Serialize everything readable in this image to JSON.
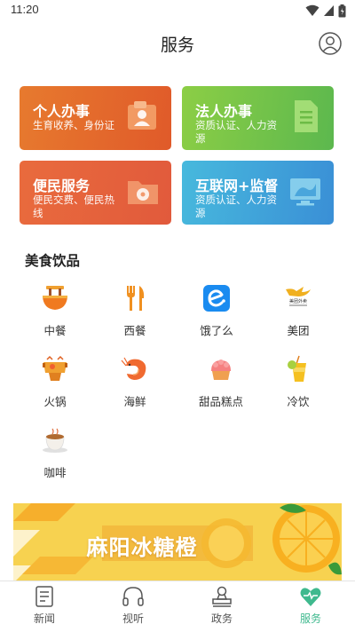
{
  "status_bar": {
    "time": "11:20"
  },
  "header": {
    "title": "服务"
  },
  "service_cards": [
    {
      "title": "个人办事",
      "subtitle": "生育收养、身份证"
    },
    {
      "title": "法人办事",
      "subtitle": "资质认证、人力资源"
    },
    {
      "title": "便民服务",
      "subtitle": "便民交费、便民热线"
    },
    {
      "title": "互联网+监督",
      "subtitle": "资质认证、人力资源"
    }
  ],
  "food_section": {
    "title": "美食饮品",
    "items": [
      {
        "label": "中餐",
        "icon": "noodle-bowl-icon"
      },
      {
        "label": "西餐",
        "icon": "fork-knife-icon"
      },
      {
        "label": "饿了么",
        "icon": "eleme-logo-icon"
      },
      {
        "label": "美团",
        "icon": "meituan-logo-icon"
      },
      {
        "label": "火锅",
        "icon": "hotpot-icon"
      },
      {
        "label": "海鲜",
        "icon": "shrimp-icon"
      },
      {
        "label": "甜品糕点",
        "icon": "cake-icon"
      },
      {
        "label": "冷饮",
        "icon": "cold-drink-icon"
      },
      {
        "label": "咖啡",
        "icon": "coffee-icon"
      }
    ]
  },
  "banner": {
    "text": "麻阳冰糖橙"
  },
  "tab_bar": {
    "tabs": [
      {
        "label": "新闻",
        "icon": "news-icon",
        "active": false
      },
      {
        "label": "视听",
        "icon": "headphones-icon",
        "active": false
      },
      {
        "label": "政务",
        "icon": "government-icon",
        "active": false
      },
      {
        "label": "服务",
        "icon": "service-heart-icon",
        "active": true
      }
    ],
    "active_color": "#3fb98e"
  },
  "colors": {
    "card_personal": "#e56a2c",
    "card_legal": "#6fc24a",
    "card_convenience": "#e4603c",
    "card_internet": "#3fa3da",
    "banner": "#f7d250"
  }
}
